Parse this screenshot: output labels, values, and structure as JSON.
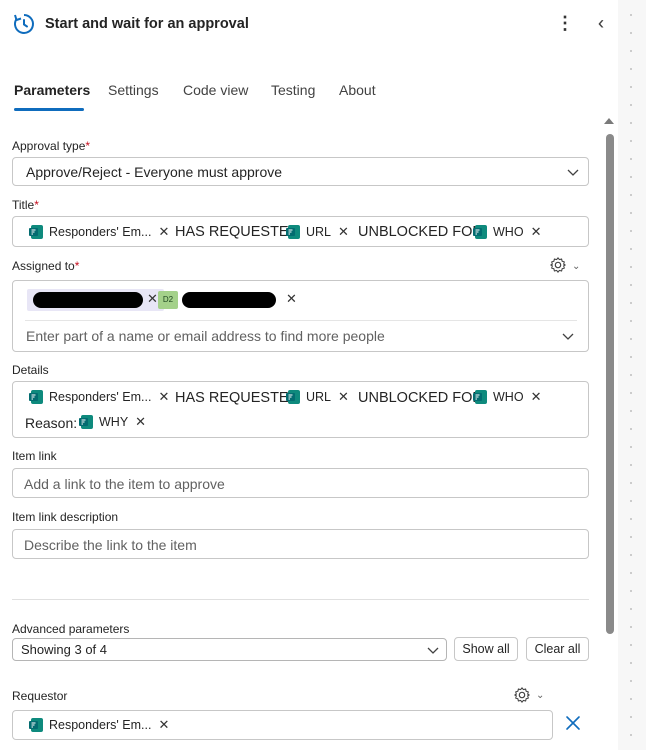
{
  "header": {
    "title": "Start and wait for an approval",
    "more_icon": "more-vertical-icon",
    "collapse_icon": "double-chevron-left-icon"
  },
  "tabs": [
    {
      "label": "Parameters",
      "active": true
    },
    {
      "label": "Settings",
      "active": false
    },
    {
      "label": "Code view",
      "active": false
    },
    {
      "label": "Testing",
      "active": false
    },
    {
      "label": "About",
      "active": false
    }
  ],
  "approval_type": {
    "label": "Approval type",
    "required_mark": "*",
    "value": "Approve/Reject - Everyone must approve"
  },
  "title_field": {
    "label": "Title",
    "required_mark": "*",
    "token1": "Responders' Em...",
    "text1": "HAS REQUESTED",
    "token2": "URL",
    "text2": "UNBLOCKED FOR",
    "token3": "WHO"
  },
  "assigned_to": {
    "label": "Assigned to",
    "required_mark": "*",
    "persona2_initials": "D2",
    "placeholder": "Enter part of a name or email address to find more people"
  },
  "details": {
    "label": "Details",
    "token1": "Responders' Em...",
    "text1": "HAS REQUESTED",
    "token2": "URL",
    "text2": "UNBLOCKED FOR",
    "token3": "WHO",
    "reason_label": "Reason:",
    "token4": "WHY"
  },
  "item_link": {
    "label": "Item link",
    "placeholder": "Add a link to the item to approve"
  },
  "item_link_description": {
    "label": "Item link description",
    "placeholder": "Describe the link to the item"
  },
  "advanced": {
    "label": "Advanced parameters",
    "select_value": "Showing 3 of 4",
    "show_all": "Show all",
    "clear_all": "Clear all"
  },
  "requestor": {
    "label": "Requestor",
    "token1": "Responders' Em...",
    "remove_icon": "close-icon"
  },
  "colors": {
    "accent": "#0f6cbd",
    "required": "#c50f1f",
    "token_icon": "#077568",
    "persona_bg": "#a4d18a"
  }
}
